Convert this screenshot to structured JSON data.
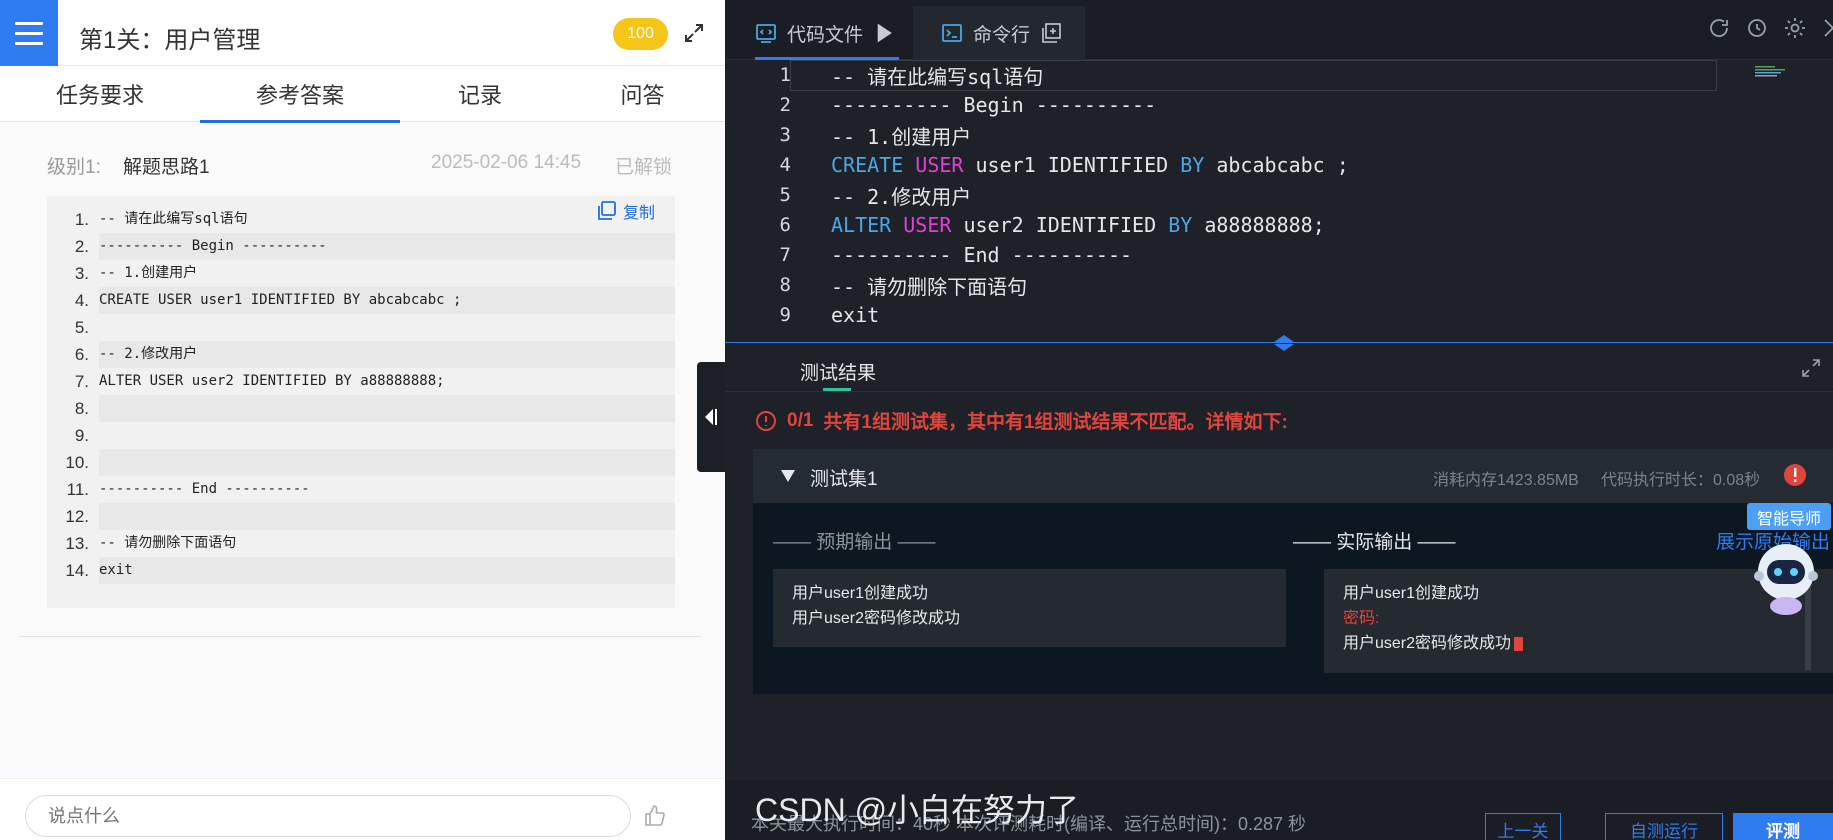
{
  "header": {
    "title": "第1关：用户管理",
    "score": "100"
  },
  "tabs": [
    "任务要求",
    "参考答案",
    "记录",
    "问答"
  ],
  "solution": {
    "level": "级别1:",
    "title": "解题思路1",
    "date": "2025-02-06 14:45",
    "status": "已解锁",
    "copy_label": "复制",
    "lines": [
      {
        "n": "1.",
        "t": "-- 请在此编写sql语句"
      },
      {
        "n": "2.",
        "t": "---------- Begin ----------"
      },
      {
        "n": "3.",
        "t": "-- 1.创建用户"
      },
      {
        "n": "4.",
        "t": "CREATE USER user1 IDENTIFIED BY abcabcabc ;"
      },
      {
        "n": "5.",
        "t": ""
      },
      {
        "n": "6.",
        "t": "-- 2.修改用户"
      },
      {
        "n": "7.",
        "t": "ALTER USER user2 IDENTIFIED BY a88888888;"
      },
      {
        "n": "8.",
        "t": ""
      },
      {
        "n": "9.",
        "t": ""
      },
      {
        "n": "10.",
        "t": ""
      },
      {
        "n": "11.",
        "t": "---------- End ----------"
      },
      {
        "n": "12.",
        "t": ""
      },
      {
        "n": "13.",
        "t": "-- 请勿删除下面语句"
      },
      {
        "n": "14.",
        "t": "exit"
      }
    ]
  },
  "chat": {
    "placeholder": "说点什么"
  },
  "editor": {
    "tab_code": "代码文件",
    "tab_cmd": "命令行",
    "lines": [
      {
        "n": "1",
        "t": "-- 请在此编写sql语句"
      },
      {
        "n": "2",
        "t": "---------- Begin ----------"
      },
      {
        "n": "3",
        "t": "-- 1.创建用户"
      },
      {
        "n": "4",
        "t": "CREATE USER user1 IDENTIFIED BY abcabcabc ;"
      },
      {
        "n": "5",
        "t": "-- 2.修改用户"
      },
      {
        "n": "6",
        "t": "ALTER USER user2 IDENTIFIED BY a88888888;"
      },
      {
        "n": "7",
        "t": "---------- End ----------"
      },
      {
        "n": "8",
        "t": "-- 请勿删除下面语句"
      },
      {
        "n": "9",
        "t": "exit"
      }
    ]
  },
  "test": {
    "title": "测试结果",
    "summary_score": "0/1",
    "summary_text": "共有1组测试集，其中有1组测试结果不匹配。详情如下:",
    "set_name": "测试集1",
    "memory": "消耗内存1423.85MB",
    "exec_time": "代码执行时长：0.08秒",
    "expected_label": "—— 预期输出 ——",
    "actual_label": "—— 实际输出 ——",
    "raw_link": "展示原始输出",
    "expected_lines": [
      "用户user1创建成功",
      "用户user2密码修改成功"
    ],
    "actual_lines": [
      "用户user1创建成功",
      "密码:",
      "用户user2密码修改成功"
    ],
    "ai_badge": "智能导师"
  },
  "footer": {
    "text": "本关最大执行时间：40秒    本次评测耗时(编译、运行总时间)：0.287 秒",
    "prev": "上一关",
    "run": "自测运行",
    "eval": "评测"
  },
  "watermark": "CSDN @小白在努力了",
  "colors": {
    "accent": "#2f7bf0",
    "error": "#e0443c",
    "badge": "#f5c518"
  }
}
